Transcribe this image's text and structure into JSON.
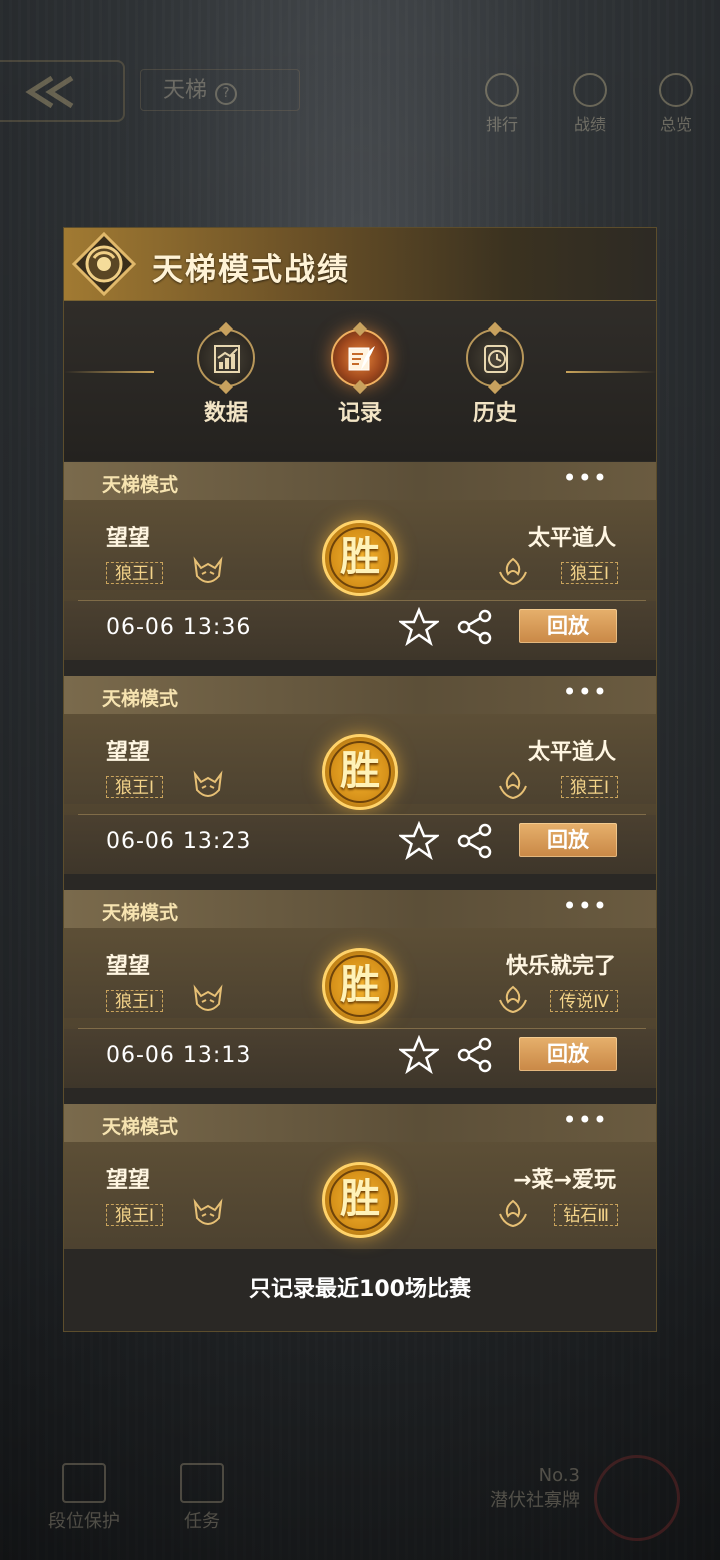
{
  "topbar": {
    "title": "天梯",
    "help": "?",
    "icons": [
      {
        "label": "排行",
        "icon": "trophy-icon"
      },
      {
        "label": "战绩",
        "icon": "shield-icon"
      },
      {
        "label": "总览",
        "icon": "overview-icon"
      }
    ]
  },
  "panel": {
    "title": "天梯模式战绩",
    "tabs": [
      {
        "label": "数据",
        "icon": "chart-icon",
        "active": false
      },
      {
        "label": "记录",
        "icon": "quill-icon",
        "active": true
      },
      {
        "label": "历史",
        "icon": "history-icon",
        "active": false
      }
    ],
    "footer_note": "只记录最近100场比赛"
  },
  "matches": [
    {
      "mode": "天梯模式",
      "more": "•••",
      "player1": "望望",
      "player1_rank": "狼王Ⅰ",
      "result": "胜",
      "player2": "太平道人",
      "player2_rank": "狼王Ⅰ",
      "time": "06-06 13:36",
      "replay": "回放"
    },
    {
      "mode": "天梯模式",
      "more": "•••",
      "player1": "望望",
      "player1_rank": "狼王Ⅰ",
      "result": "胜",
      "player2": "太平道人",
      "player2_rank": "狼王Ⅰ",
      "time": "06-06 13:23",
      "replay": "回放"
    },
    {
      "mode": "天梯模式",
      "more": "•••",
      "player1": "望望",
      "player1_rank": "狼王Ⅰ",
      "result": "胜",
      "player2": "快乐就完了",
      "player2_rank": "传说Ⅳ",
      "time": "06-06 13:13",
      "replay": "回放"
    },
    {
      "mode": "天梯模式",
      "more": "•••",
      "player1": "望望",
      "player1_rank": "狼王Ⅰ",
      "result": "胜",
      "player2": "→菜→爱玩",
      "player2_rank": "钻石Ⅲ"
    }
  ],
  "bottombar": {
    "items": [
      {
        "label": "段位保护",
        "icon": "shield-badge-icon"
      },
      {
        "label": "任务",
        "icon": "task-icon"
      }
    ],
    "rank_no": "No.3",
    "rank_name": "潜伏社寡牌"
  },
  "colors": {
    "accent_gold": "#c9a25e",
    "win_gold": "#f7b631",
    "replay_button": "#d99a56"
  }
}
